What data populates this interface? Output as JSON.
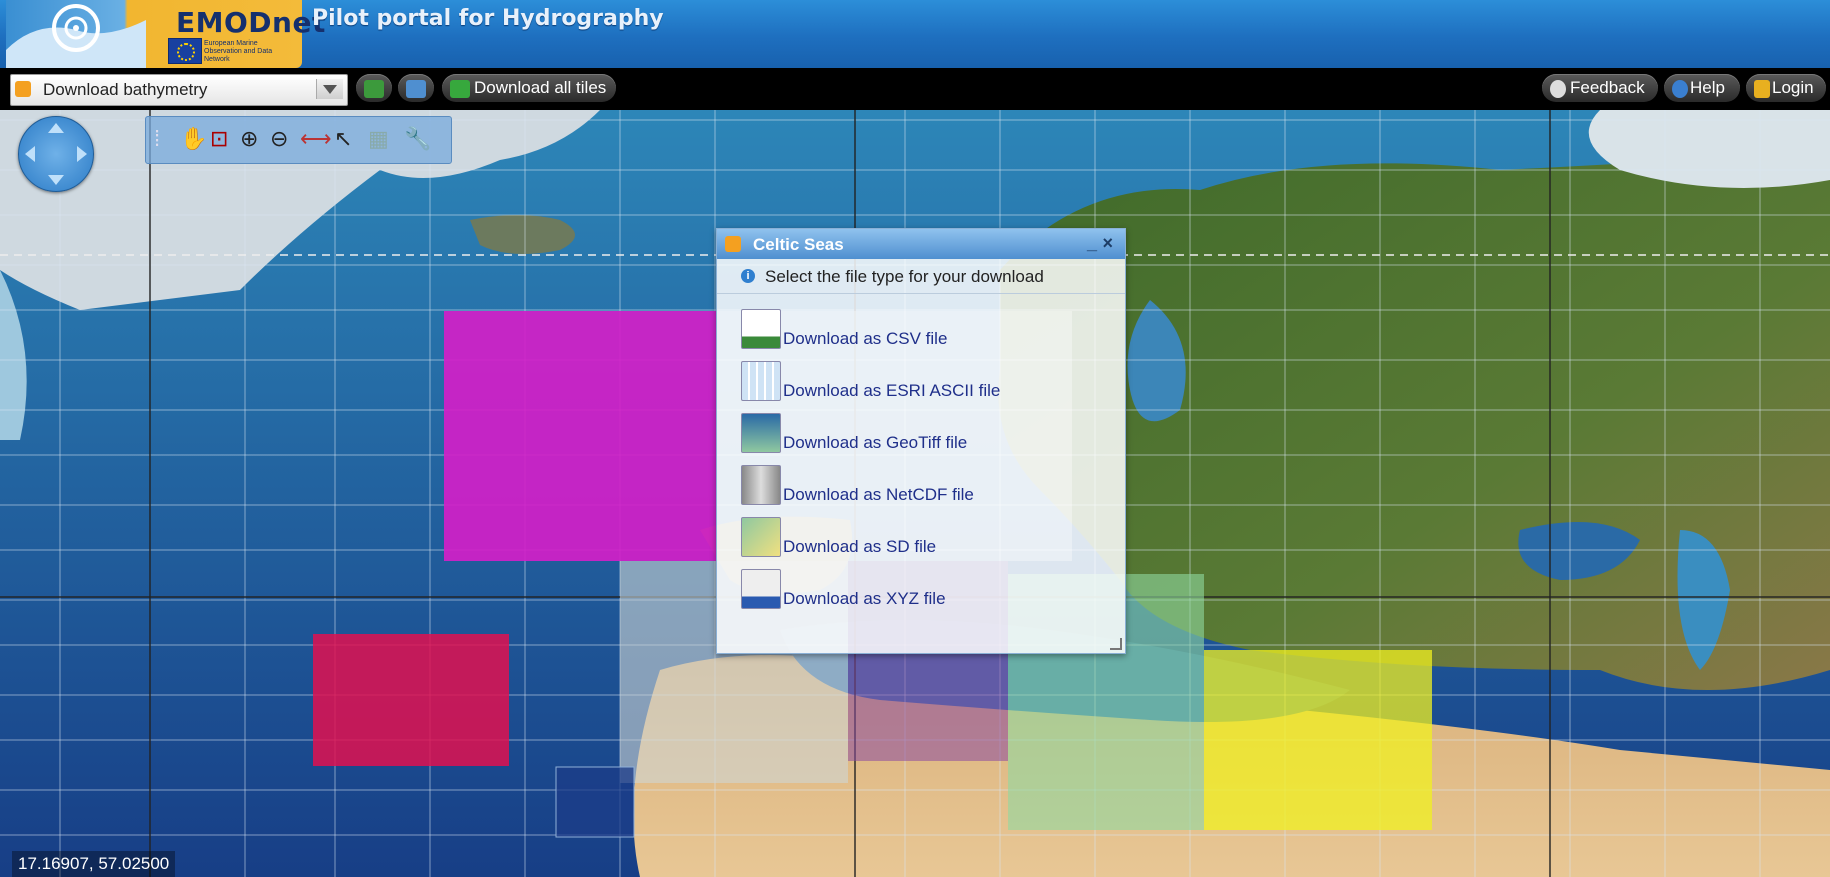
{
  "header": {
    "logo_text": "EMODnet",
    "logo_subtitle": "European Marine Observation and Data Network",
    "portal_title": "Pilot portal for Hydrography"
  },
  "toolbar": {
    "layer_select_value": "Download bathymetry",
    "download_all_label": "Download all tiles",
    "feedback_label": "Feedback",
    "help_label": "Help",
    "login_label": "Login"
  },
  "map": {
    "coordinates": "17.16907, 57.02500",
    "tools": [
      "navigation",
      "pan",
      "zoom-box",
      "zoom-in",
      "zoom-out",
      "measure",
      "info",
      "legend",
      "settings"
    ]
  },
  "dialog": {
    "title": "Celtic Seas",
    "info": "Select the file type for your download",
    "options": [
      {
        "label": "Download as CSV file",
        "icon": "csv-icon"
      },
      {
        "label": "Download as ESRI ASCII file",
        "icon": "esri-ascii-icon"
      },
      {
        "label": "Download as GeoTiff file",
        "icon": "geotiff-icon"
      },
      {
        "label": "Download as NetCDF file",
        "icon": "netcdf-icon"
      },
      {
        "label": "Download as SD file",
        "icon": "sd-icon"
      },
      {
        "label": "Download as XYZ file",
        "icon": "xyz-icon"
      }
    ]
  },
  "colors": {
    "header_blue": "#1e6fbf",
    "toolbar_black": "#000000",
    "tile_magenta": "#d21fc8",
    "tile_red": "#e01050",
    "tile_yellow": "#f0f020",
    "link_blue": "#1f2f8a"
  }
}
